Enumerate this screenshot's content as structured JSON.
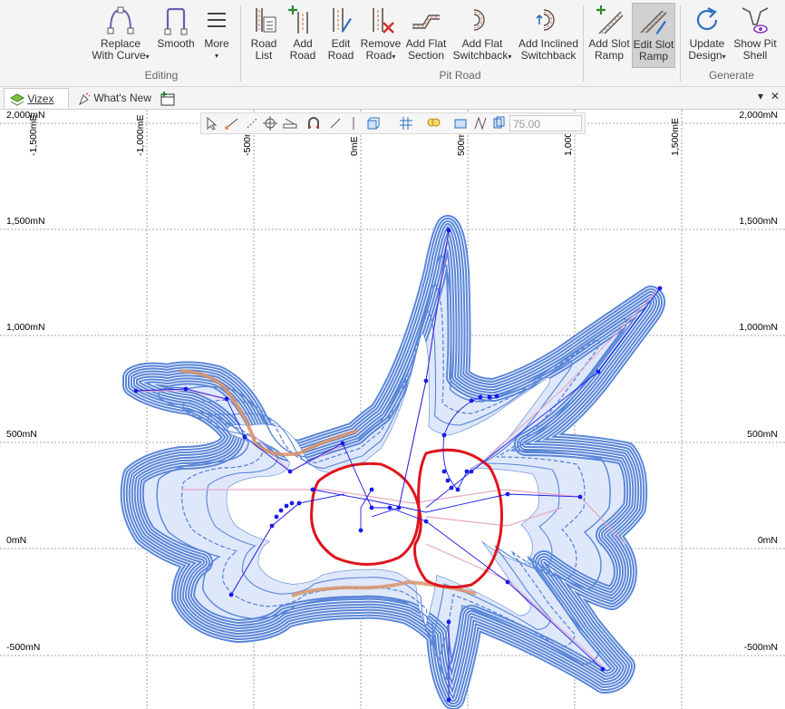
{
  "ribbon": {
    "editing": {
      "group_label": "Editing",
      "replace_with_curve": "Replace\nWith Curve",
      "replace_line1": "Replace",
      "replace_line2": "With Curve",
      "smooth": "Smooth",
      "more": "More"
    },
    "pit_road": {
      "group_label": "Pit Road",
      "road_list_1": "Road",
      "road_list_2": "List",
      "add_road_1": "Add",
      "add_road_2": "Road",
      "edit_road_1": "Edit",
      "edit_road_2": "Road",
      "remove_road_1": "Remove",
      "remove_road_2": "Road",
      "add_flat_section_1": "Add Flat",
      "add_flat_section_2": "Section",
      "add_flat_switchback_1": "Add Flat",
      "add_flat_switchback_2": "Switchback",
      "add_inclined_switchback_1": "Add Inclined",
      "add_inclined_switchback_2": "Switchback",
      "add_slot_ramp_1": "Add Slot",
      "add_slot_ramp_2": "Ramp",
      "edit_slot_ramp_1": "Edit Slot",
      "edit_slot_ramp_2": "Ramp"
    },
    "generate": {
      "group_label": "Generate",
      "update_design_1": "Update",
      "update_design_2": "Design",
      "show_pit_shell_1": "Show Pit",
      "show_pit_shell_2": "Shell"
    },
    "dropdown_glyph": "▾"
  },
  "tabs": [
    {
      "label": "Vizex",
      "close": "✕"
    },
    {
      "label": "What's New"
    }
  ],
  "window_controls": {
    "dropdown": "▾",
    "close": "✕"
  },
  "viewer_toolbar": {
    "zoom_value": "75.00"
  },
  "axes": {
    "x_top": [
      "-1,500mE",
      "-1,000mE",
      "-500mE",
      "0mE",
      "500mE",
      "1,000mE",
      "1,500mE"
    ],
    "y_left": [
      "2,000mN",
      "1,500mN",
      "1,000mN",
      "500mN",
      "0mN",
      "-500mN"
    ],
    "y_right": [
      "2,000mN",
      "1,500mN",
      "1,000mN",
      "500mN",
      "0mN",
      "-500mN"
    ]
  },
  "colors": {
    "bench": "#5a86d8",
    "pit_outline": "#e0141b",
    "ramp": "#d9926a",
    "nodes": "#1a1aee",
    "grid": "#8a8a8a",
    "accent_green": "#2d8a2d",
    "accent_red": "#d22b2b"
  }
}
